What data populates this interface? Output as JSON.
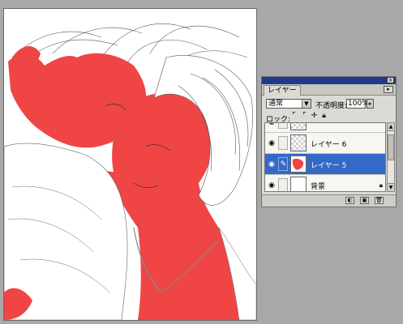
{
  "palette": {
    "tab_label": "レイヤー",
    "menu_icon": "palette-menu-icon",
    "blend_mode": "通常",
    "opacity_label": "不透明度:",
    "opacity_value": "100%",
    "lock_label": "ロック:",
    "layers": [
      {
        "name": "",
        "selected": false,
        "thumb": "checker"
      },
      {
        "name": "レイヤー 6",
        "selected": false,
        "thumb": "checker"
      },
      {
        "name": "レイヤー 5",
        "selected": true,
        "thumb": "red"
      },
      {
        "name": "背景",
        "selected": false,
        "thumb": "white",
        "locked": true
      }
    ]
  },
  "colors": {
    "selection": "#3569c8",
    "paint_red": "#f04545",
    "titlebar": "#1f3a8a"
  }
}
